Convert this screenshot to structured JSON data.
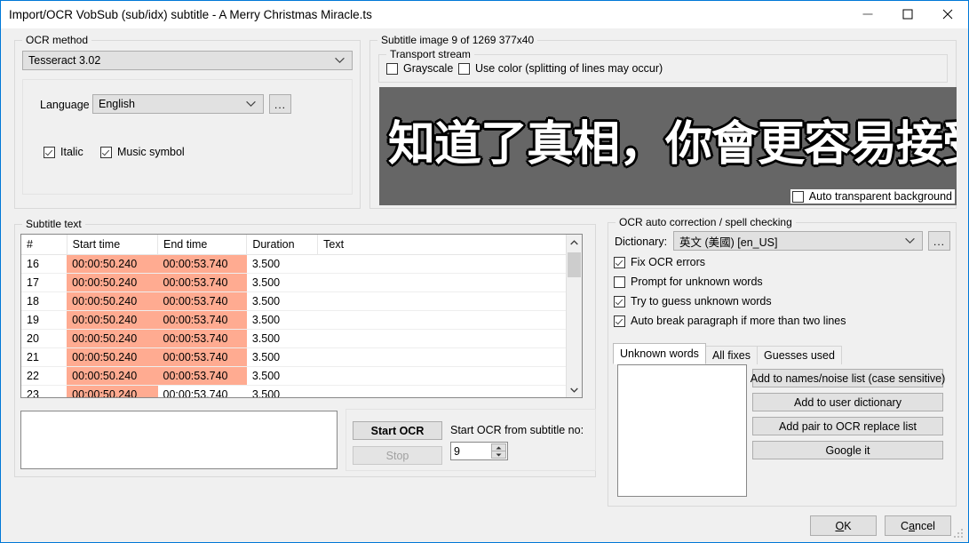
{
  "window": {
    "title": "Import/OCR VobSub (sub/idx) subtitle - A Merry Christmas Miracle.ts",
    "minimize_icon": "minimize-icon",
    "maximize_icon": "maximize-icon",
    "close_icon": "close-icon",
    "accent_color": "#0078d7"
  },
  "ocr_method": {
    "group_label": "OCR method",
    "engine": "Tesseract 3.02",
    "language_label": "Language",
    "language_value": "English",
    "browse_label": "...",
    "italic_label": "Italic",
    "italic_checked": true,
    "music_symbol_label": "Music symbol",
    "music_symbol_checked": true
  },
  "subtitle_image": {
    "group_label": "Subtitle image 9 of 1269   377x40",
    "transport_stream_label": "Transport stream",
    "grayscale_label": "Grayscale",
    "grayscale_checked": false,
    "use_color_label": "Use color (splitting of lines may occur)",
    "use_color_checked": false,
    "preview_text": "知道了真相，你會更容易接受現實",
    "preview_bg": "#666666",
    "auto_transparent_label": "Auto transparent background",
    "auto_transparent_checked": false
  },
  "subtitle_text": {
    "group_label": "Subtitle text",
    "columns": [
      "#",
      "Start time",
      "End time",
      "Duration",
      "Text"
    ],
    "highlight_color": "#ffab91",
    "rows": [
      {
        "num": "16",
        "start": "00:00:50.240",
        "end": "00:00:53.740",
        "duration": "3.500",
        "text": ""
      },
      {
        "num": "17",
        "start": "00:00:50.240",
        "end": "00:00:53.740",
        "duration": "3.500",
        "text": ""
      },
      {
        "num": "18",
        "start": "00:00:50.240",
        "end": "00:00:53.740",
        "duration": "3.500",
        "text": ""
      },
      {
        "num": "19",
        "start": "00:00:50.240",
        "end": "00:00:53.740",
        "duration": "3.500",
        "text": ""
      },
      {
        "num": "20",
        "start": "00:00:50.240",
        "end": "00:00:53.740",
        "duration": "3.500",
        "text": ""
      },
      {
        "num": "21",
        "start": "00:00:50.240",
        "end": "00:00:53.740",
        "duration": "3.500",
        "text": ""
      },
      {
        "num": "22",
        "start": "00:00:50.240",
        "end": "00:00:53.740",
        "duration": "3.500",
        "text": ""
      },
      {
        "num": "23",
        "start": "00:00:50.240",
        "end": "00:00:53.740",
        "duration": "3.500",
        "text": ""
      }
    ]
  },
  "ocr_controls": {
    "start_ocr_label": "Start OCR",
    "stop_label": "Stop",
    "stop_disabled": true,
    "start_from_label": "Start OCR from subtitle no:",
    "start_from_value": "9",
    "output_text": ""
  },
  "auto_correction": {
    "group_label": "OCR auto correction / spell checking",
    "dictionary_label": "Dictionary:",
    "dictionary_value": "英文 (美國) [en_US]",
    "browse_label": "...",
    "fix_ocr_errors_label": "Fix OCR errors",
    "fix_ocr_errors_checked": true,
    "prompt_unknown_label": "Prompt for unknown words",
    "prompt_unknown_checked": false,
    "guess_unknown_label": "Try to guess unknown words",
    "guess_unknown_checked": true,
    "auto_break_label": "Auto break paragraph if more than two lines",
    "auto_break_checked": true,
    "tabs": [
      {
        "label": "Unknown words",
        "active": true
      },
      {
        "label": "All fixes",
        "active": false
      },
      {
        "label": "Guesses used",
        "active": false
      }
    ],
    "list_items": [],
    "buttons": [
      "Add to names/noise list (case sensitive)",
      "Add to user dictionary",
      "Add pair to OCR replace list",
      "Google it"
    ]
  },
  "footer": {
    "ok_prefix": "",
    "ok_accel": "O",
    "ok_suffix": "K",
    "cancel_prefix": "C",
    "cancel_accel": "a",
    "cancel_suffix": "ncel"
  }
}
